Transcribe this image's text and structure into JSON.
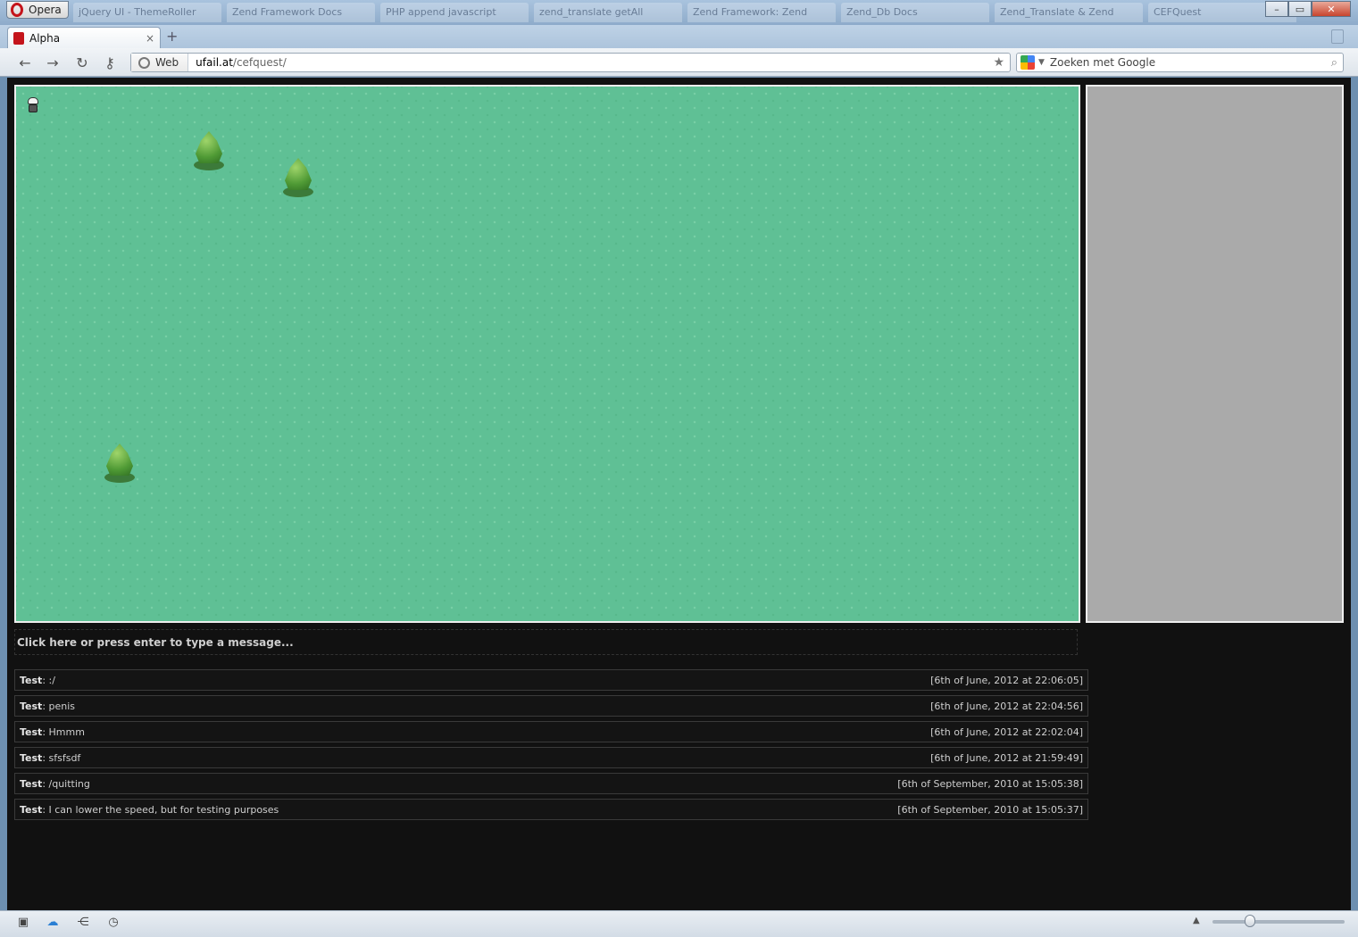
{
  "browser": {
    "menu_label": "Opera",
    "background_tabs": [
      "jQuery UI - ThemeRoller",
      "Zend Framework Docs",
      "PHP append javascript",
      "zend_translate getAll",
      "Zend Framework: Zend",
      "Zend_Db Docs",
      "Zend_Translate & Zend",
      "CEFQuest"
    ],
    "active_tab": {
      "title": "Alpha",
      "close": "×"
    },
    "newtab_symbol": "+",
    "address": {
      "badge": "Web",
      "host": "ufail.at",
      "path": "/cefquest/"
    },
    "search": {
      "placeholder": "Zoeken met Google"
    },
    "window_controls": {
      "minimize": "–",
      "maximize": "▭",
      "close": "✕"
    }
  },
  "game": {
    "message_prompt": "Click here or press enter to type a message..."
  },
  "chat": [
    {
      "user": "Test",
      "text": ": :/",
      "time": "[6th of June, 2012 at 22:06:05]"
    },
    {
      "user": "Test",
      "text": ": penis",
      "time": "[6th of June, 2012 at 22:04:56]"
    },
    {
      "user": "Test",
      "text": ": Hmmm",
      "time": "[6th of June, 2012 at 22:02:04]"
    },
    {
      "user": "Test",
      "text": ": sfsfsdf",
      "time": "[6th of June, 2012 at 21:59:49]"
    },
    {
      "user": "Test",
      "text": ": /quitting",
      "time": "[6th of September, 2010 at 15:05:38]"
    },
    {
      "user": "Test",
      "text": ": I can lower the speed, but for testing purposes",
      "time": "[6th of September, 2010 at 15:05:37]"
    }
  ],
  "colors": {
    "grass": "#5fc095",
    "sidepanel": "#aaaaaa",
    "page_bg": "#111111"
  }
}
